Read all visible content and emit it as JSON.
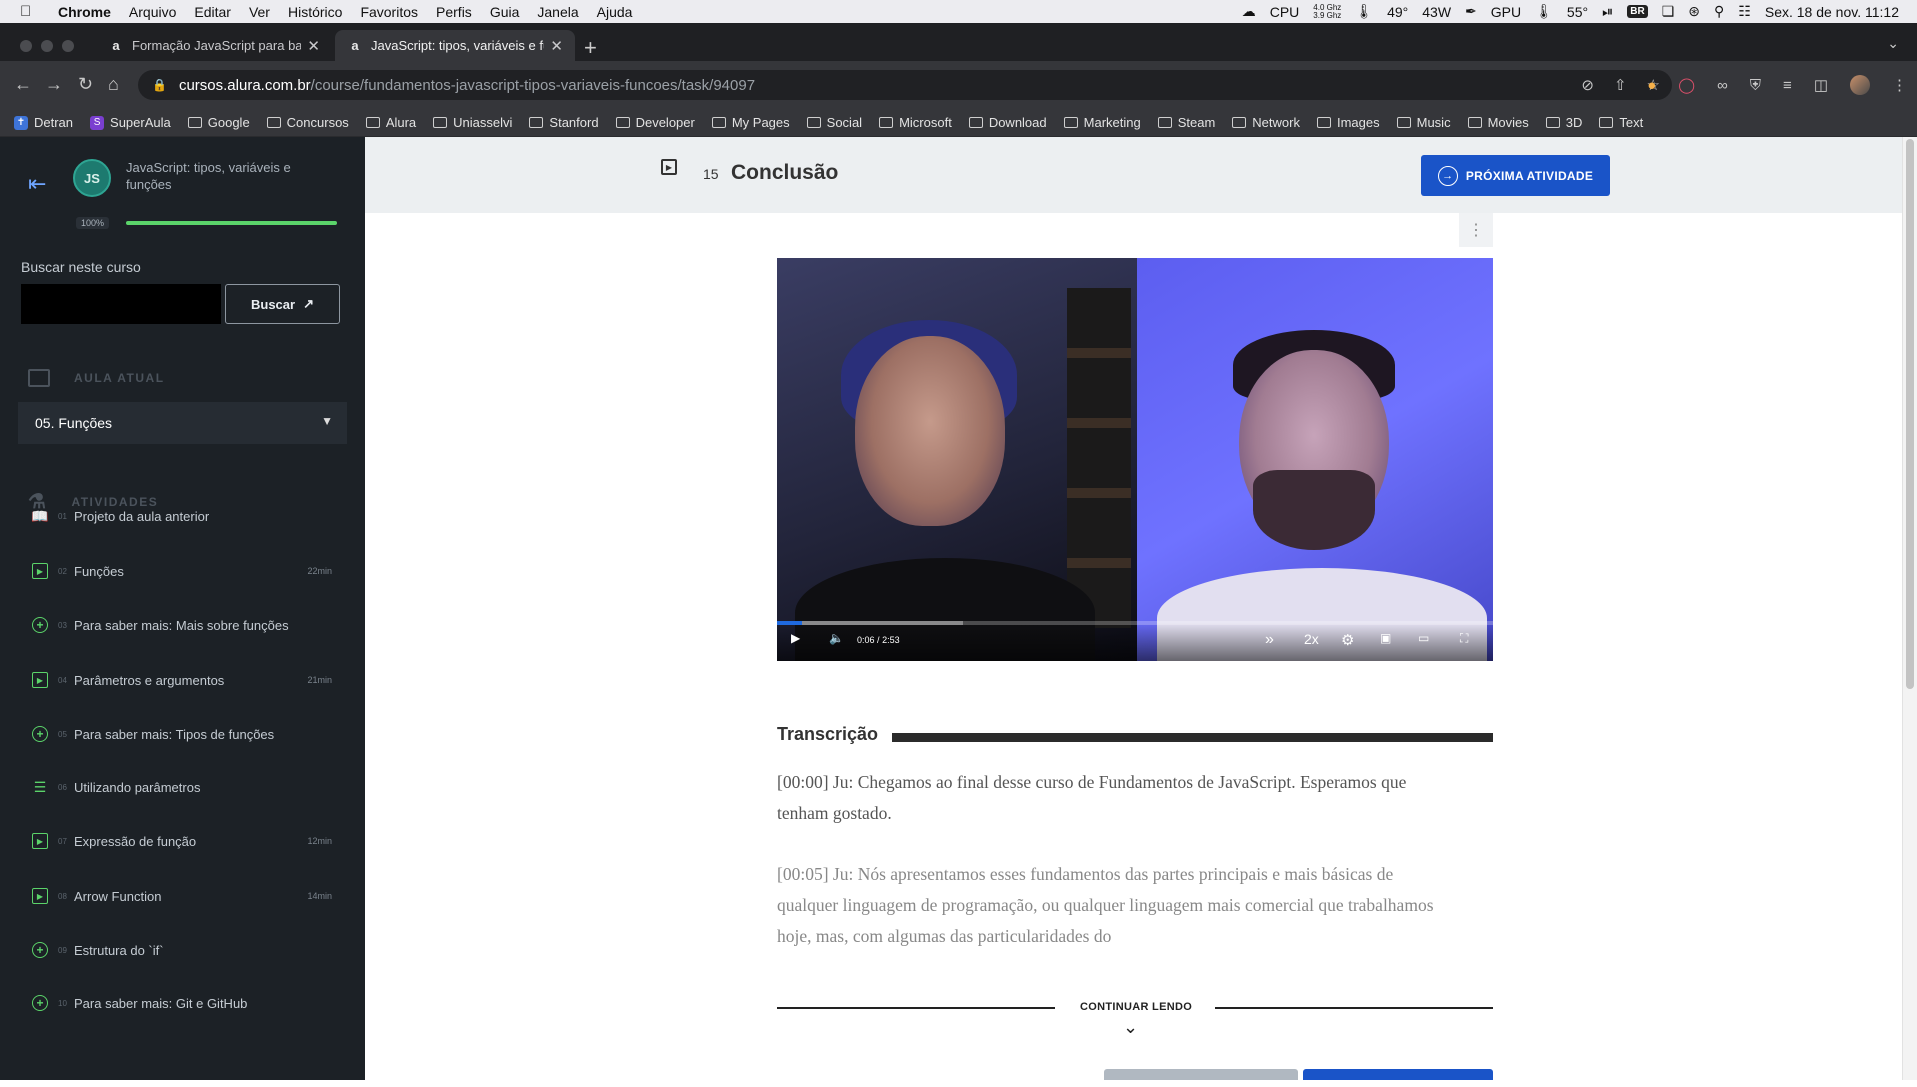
{
  "menubar": {
    "app": "Chrome",
    "items": [
      "Arquivo",
      "Editar",
      "Ver",
      "Histórico",
      "Favoritos",
      "Perfis",
      "Guia",
      "Janela",
      "Ajuda"
    ],
    "cpu_label": "CPU",
    "cpu_freq_top": "4.0 Ghz",
    "cpu_freq_bottom": "3.9 Ghz",
    "cpu_temp": "49°",
    "power": "43W",
    "gpu_label": "GPU",
    "gpu_temp": "55°",
    "keyboard": "BR",
    "datetime": "Sex. 18 de nov.  11:12"
  },
  "browser": {
    "tabs": [
      {
        "label": "Formação JavaScript para back-end",
        "favicon": "a"
      },
      {
        "label": "JavaScript: tipos, variáveis e funções",
        "favicon": "a"
      }
    ],
    "url_host": "cursos.alura.com.br",
    "url_path": "/course/fundamentos-javascript-tipos-variaveis-funcoes/task/94097",
    "bookmarks": [
      {
        "label": "Detran",
        "type": "site"
      },
      {
        "label": "SuperAula",
        "type": "site"
      },
      {
        "label": "Google",
        "type": "folder"
      },
      {
        "label": "Concursos",
        "type": "folder"
      },
      {
        "label": "Alura",
        "type": "folder"
      },
      {
        "label": "Uniasselvi",
        "type": "folder"
      },
      {
        "label": "Stanford",
        "type": "folder"
      },
      {
        "label": "Developer",
        "type": "folder"
      },
      {
        "label": "My Pages",
        "type": "folder"
      },
      {
        "label": "Social",
        "type": "folder"
      },
      {
        "label": "Microsoft",
        "type": "folder"
      },
      {
        "label": "Download",
        "type": "folder"
      },
      {
        "label": "Marketing",
        "type": "folder"
      },
      {
        "label": "Steam",
        "type": "folder"
      },
      {
        "label": "Network",
        "type": "folder"
      },
      {
        "label": "Images",
        "type": "folder"
      },
      {
        "label": "Music",
        "type": "folder"
      },
      {
        "label": "Movies",
        "type": "folder"
      },
      {
        "label": "3D",
        "type": "folder"
      },
      {
        "label": "Text",
        "type": "folder"
      }
    ]
  },
  "sidebar": {
    "course_logo": "JS",
    "course_title": "JavaScript: tipos, variáveis e funções",
    "progress_label": "100%",
    "progress_value": 1.0,
    "search_label": "Buscar neste curso",
    "search_placeholder": "",
    "search_button": "Buscar",
    "current_lesson_heading": "AULA ATUAL",
    "current_lesson": "05. Funções",
    "activities_heading": "ATIVIDADES",
    "activities": [
      {
        "num": "01",
        "title": "Projeto da aula anterior",
        "duration": "",
        "icon": "book-icon"
      },
      {
        "num": "02",
        "title": "Funções",
        "duration": "22min",
        "icon": "video-icon"
      },
      {
        "num": "03",
        "title": "Para saber mais: Mais sobre funções",
        "duration": "",
        "icon": "plus-circle-icon"
      },
      {
        "num": "04",
        "title": "Parâmetros e argumentos",
        "duration": "21min",
        "icon": "video-icon"
      },
      {
        "num": "05",
        "title": "Para saber mais: Tipos de funções",
        "duration": "",
        "icon": "plus-circle-icon"
      },
      {
        "num": "06",
        "title": "Utilizando parâmetros",
        "duration": "",
        "icon": "list-icon"
      },
      {
        "num": "07",
        "title": "Expressão de função",
        "duration": "12min",
        "icon": "video-icon"
      },
      {
        "num": "08",
        "title": "Arrow Function",
        "duration": "14min",
        "icon": "video-icon"
      },
      {
        "num": "09",
        "title": "Estrutura do `if`",
        "duration": "",
        "icon": "plus-circle-icon"
      },
      {
        "num": "10",
        "title": "Para saber mais: Git e GitHub",
        "duration": "",
        "icon": "plus-circle-icon"
      }
    ]
  },
  "task": {
    "number": "15",
    "title": "Conclusão",
    "next_button": "PRÓXIMA ATIVIDADE"
  },
  "video": {
    "current_time": "0:06",
    "separator": "/",
    "duration": "2:53",
    "played_fraction": 0.035,
    "buffered_fraction": 0.26,
    "speed": "2x"
  },
  "transcript": {
    "heading": "Transcrição",
    "paragraphs": [
      "[00:00] Ju: Chegamos ao final desse curso de Fundamentos de JavaScript. Esperamos que tenham gostado.",
      "[00:05] Ju: Nós apresentamos esses fundamentos das partes principais e mais básicas de qualquer linguagem de programação, ou qualquer linguagem mais comercial que trabalhamos hoje, mas, com algumas das particularidades do"
    ],
    "continue_label": "CONTINUAR LENDO"
  },
  "colors": {
    "accent": "#1a54c8",
    "progress": "#5bd46a",
    "sidebar_bg": "#1c2126"
  }
}
